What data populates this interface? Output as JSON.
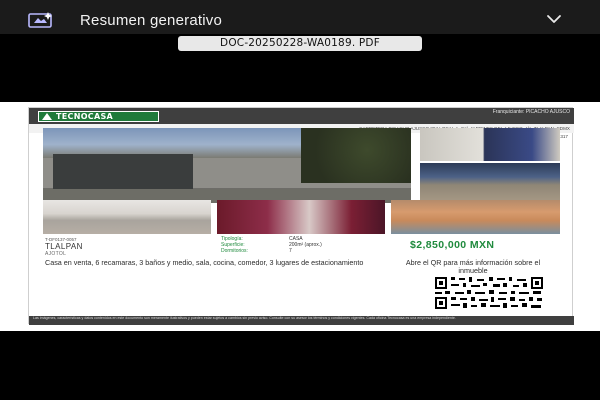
{
  "header": {
    "title": "Resumen generativo",
    "icon": "generative-summary-icon",
    "expand_icon": "chevron-down-icon"
  },
  "file": {
    "name": "DOC-20250228-WA0189. PDF"
  },
  "flyer": {
    "brand": "TECNOCASA",
    "franchise": "Franquiciante: PICACHO AJUSCO",
    "address": "CARRETERA PICACHO AJUSCO 884 LOCAL A, Col. JARDINES DEL AJUSCO, Alc. TLALPAN, CDMX",
    "contact": "E-mail: picachoajusco@tecnocasa.mx - Tel. 5584486818 / 5566951317",
    "reference": "T-DF0137-0057",
    "city": "TLALPAN",
    "zone": "AJOTOL",
    "specs": [
      {
        "label": "Tipología:",
        "value": "CASA"
      },
      {
        "label": "Superficie:",
        "value": "200m² (aprox.)"
      },
      {
        "label": "Dormitorios:",
        "value": "7"
      }
    ],
    "price": "$2,850,000 MXN",
    "description": "Casa en venta, 6 recamaras, 3 baños y medio, sala, cocina, comedor, 3 lugares de estacionamiento",
    "qr_text": "Abre el QR para más información sobre el inmueble",
    "disclaimer": "Las imágenes, características y datos contenidos en este documento son meramente ilustrativos y pueden estar sujetos a cambios sin previo aviso. Consulte con su asesor los términos y condiciones vigentes. Cada oficina Tecnocasa es una empresa independiente."
  },
  "colors": {
    "topbar": "#1b1b1b",
    "brand_green": "#1f8a3d",
    "flyer_header": "#3f3f3f"
  }
}
